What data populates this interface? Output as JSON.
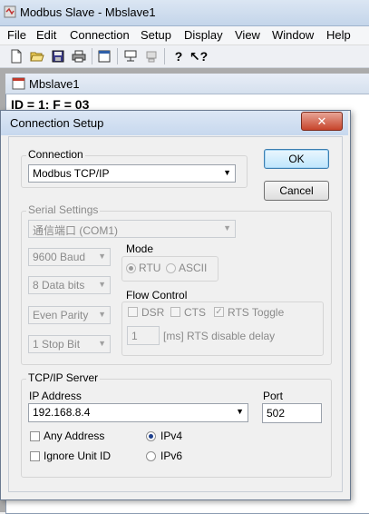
{
  "window": {
    "title": "Modbus Slave - Mbslave1"
  },
  "menu": {
    "items": [
      "File",
      "Edit",
      "Connection",
      "Setup",
      "Display",
      "View",
      "Window",
      "Help"
    ]
  },
  "toolbar": {
    "icons": [
      "new-icon",
      "open-icon",
      "save-icon",
      "print-icon",
      "window-icon",
      "connect-icon",
      "disconnect-icon",
      "help-icon",
      "context-help-icon"
    ]
  },
  "child": {
    "title": "Mbslave1",
    "id_line": "ID = 1: F = 03"
  },
  "dialog": {
    "title": "Connection Setup",
    "close_label": "✕",
    "ok_label": "OK",
    "cancel_label": "Cancel",
    "connection": {
      "label": "Connection",
      "value": "Modbus TCP/IP"
    },
    "serial": {
      "label": "Serial Settings",
      "port": "通信端口 (COM1)",
      "baud": "9600 Baud",
      "data_bits": "8 Data bits",
      "parity": "Even Parity",
      "stop_bits": "1 Stop Bit",
      "mode_label": "Mode",
      "mode_rtu": "RTU",
      "mode_ascii": "ASCII",
      "flow_label": "Flow Control",
      "dsr": "DSR",
      "cts": "CTS",
      "rts_toggle": "RTS Toggle",
      "rts_delay_value": "1",
      "rts_delay_label": "[ms] RTS disable delay"
    },
    "tcp": {
      "label": "TCP/IP Server",
      "ip_label": "IP Address",
      "ip_value": "192.168.8.4",
      "port_label": "Port",
      "port_value": "502",
      "any_address": "Any Address",
      "ignore_unit_id": "Ignore Unit ID",
      "ipv4": "IPv4",
      "ipv6": "IPv6"
    }
  }
}
